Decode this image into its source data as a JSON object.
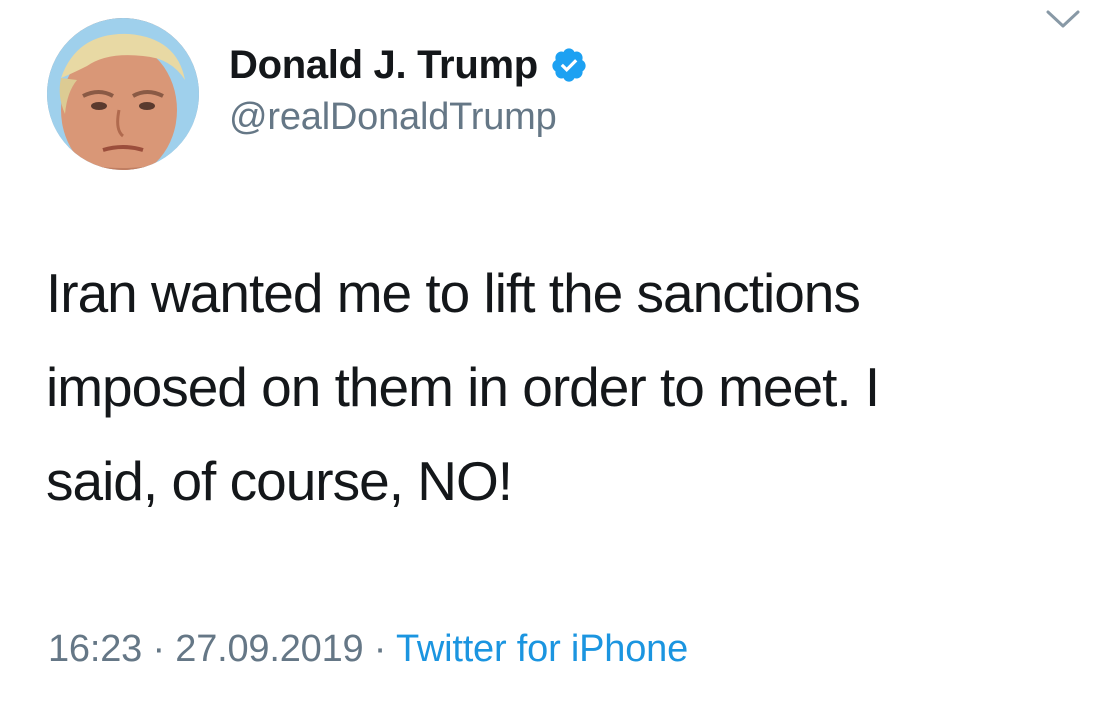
{
  "author": {
    "name": "Donald J. Trump",
    "handle": "@realDonaldTrump",
    "verified": true,
    "avatar_icon": "profile-photo"
  },
  "tweet": {
    "text": "Iran wanted me to lift the sanctions\nimposed on them in order to meet. I\nsaid, of course, NO!"
  },
  "meta": {
    "time": "16:23",
    "separator": " · ",
    "date": "27.09.2019",
    "source": "Twitter for iPhone"
  },
  "icons": {
    "verified": "verified-badge-icon",
    "menu": "chevron-down-icon"
  },
  "colors": {
    "text": "#14171a",
    "secondary": "#657786",
    "link": "#1b95e0",
    "verified": "#1da1f2"
  }
}
